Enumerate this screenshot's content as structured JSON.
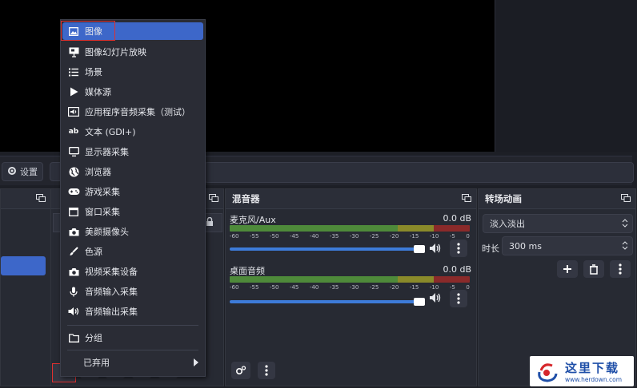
{
  "toolbar": {
    "settings_label": "设置"
  },
  "docks": {
    "mixer_title": "混音器",
    "transitions_title": "转场动画"
  },
  "mixer": {
    "channels": [
      {
        "name": "麦克风/Aux",
        "db": "0.0 dB"
      },
      {
        "name": "桌面音频",
        "db": "0.0 dB"
      }
    ],
    "scale": [
      "-60",
      "-55",
      "-50",
      "-45",
      "-40",
      "-35",
      "-30",
      "-25",
      "-20",
      "-15",
      "-10",
      "-5",
      "0"
    ]
  },
  "transitions": {
    "selected": "淡入淡出",
    "duration_label": "时长",
    "duration_value": "300 ms"
  },
  "menu": {
    "items": [
      {
        "label": "图像",
        "icon": "image-icon"
      },
      {
        "label": "图像幻灯片放映",
        "icon": "slideshow-icon"
      },
      {
        "label": "场景",
        "icon": "list-icon"
      },
      {
        "label": "媒体源",
        "icon": "play-icon"
      },
      {
        "label": "应用程序音频采集（测试）",
        "icon": "app-audio-icon"
      },
      {
        "label": "文本 (GDI+)",
        "icon": "text-icon"
      },
      {
        "label": "显示器采集",
        "icon": "monitor-icon"
      },
      {
        "label": "浏览器",
        "icon": "globe-icon"
      },
      {
        "label": "游戏采集",
        "icon": "gamepad-icon"
      },
      {
        "label": "窗口采集",
        "icon": "window-icon"
      },
      {
        "label": "美颜摄像头",
        "icon": "camera-icon"
      },
      {
        "label": "色源",
        "icon": "brush-icon"
      },
      {
        "label": "视频采集设备",
        "icon": "video-camera-icon"
      },
      {
        "label": "音频输入采集",
        "icon": "microphone-icon"
      },
      {
        "label": "音频输出采集",
        "icon": "speaker-icon"
      },
      {
        "label": "分组",
        "icon": "folder-icon"
      },
      {
        "label": "已弃用",
        "icon": "chevron-right-icon"
      }
    ]
  },
  "watermark": {
    "title": "这里下载",
    "url": "www.herdown.com"
  },
  "colors": {
    "accent": "#3d67c9",
    "highlight_box": "#e03030",
    "meter_green": "#4e8a3a",
    "meter_yellow": "#8a8a2a",
    "meter_red": "#8a2a2a"
  }
}
